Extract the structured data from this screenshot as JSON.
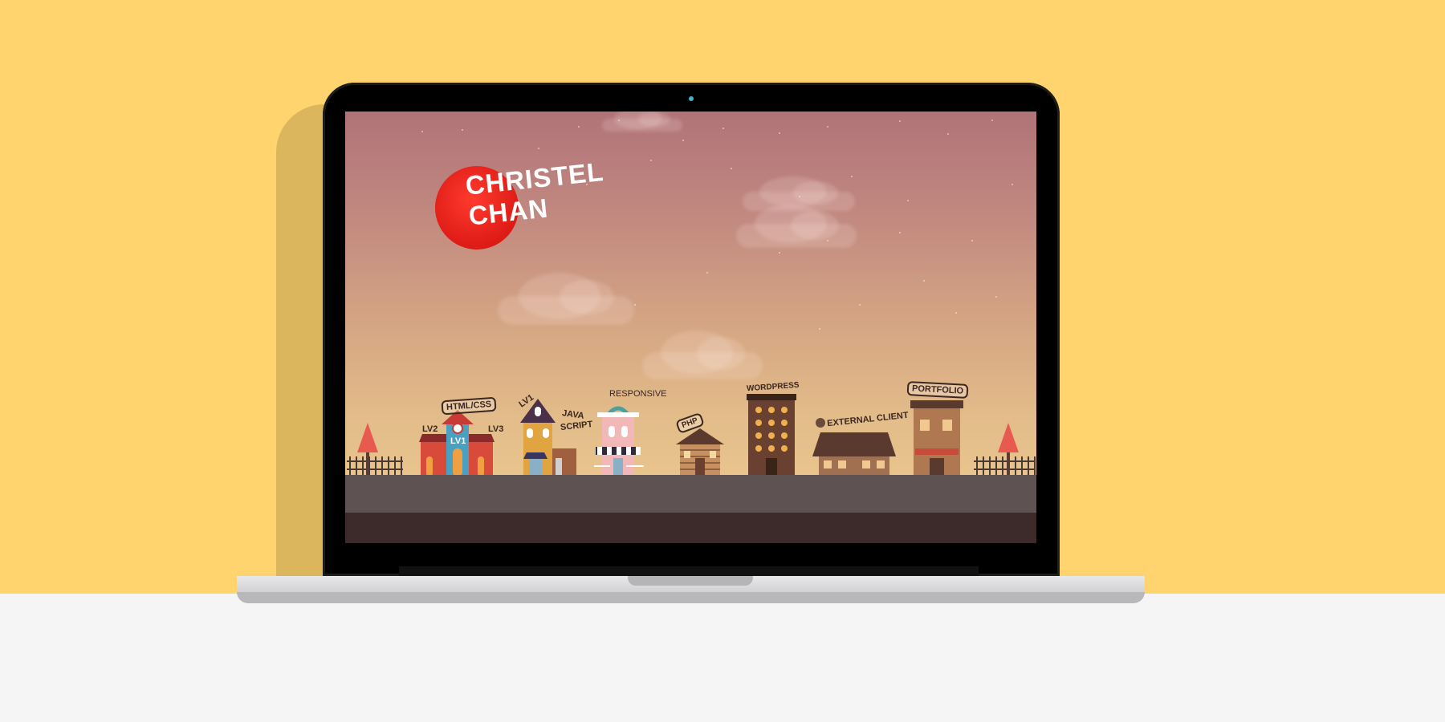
{
  "colors": {
    "background_top": "#ffd36d",
    "background_bottom": "#f5f5f5",
    "shadow": "#dcb65c",
    "logo_red": "#e8241c"
  },
  "logo": {
    "line1": "CHRISTEL",
    "line2": "CHAN"
  },
  "houses": [
    {
      "name": "html-css",
      "sign": "HTML/CSS",
      "levels": [
        "LV2",
        "LV1",
        "LV3"
      ]
    },
    {
      "name": "javascript",
      "sign_lines": [
        "JAVA",
        "SCRIPT"
      ],
      "level": "LV1"
    },
    {
      "name": "responsive",
      "sign": "RESPONSIVE"
    },
    {
      "name": "php",
      "sign": "PHP"
    },
    {
      "name": "wordpress",
      "sign": "WORDPRESS"
    },
    {
      "name": "external-client",
      "sign": "EXTERNAL CLIENT"
    },
    {
      "name": "portfolio",
      "sign": "PORTFOLIO"
    }
  ]
}
